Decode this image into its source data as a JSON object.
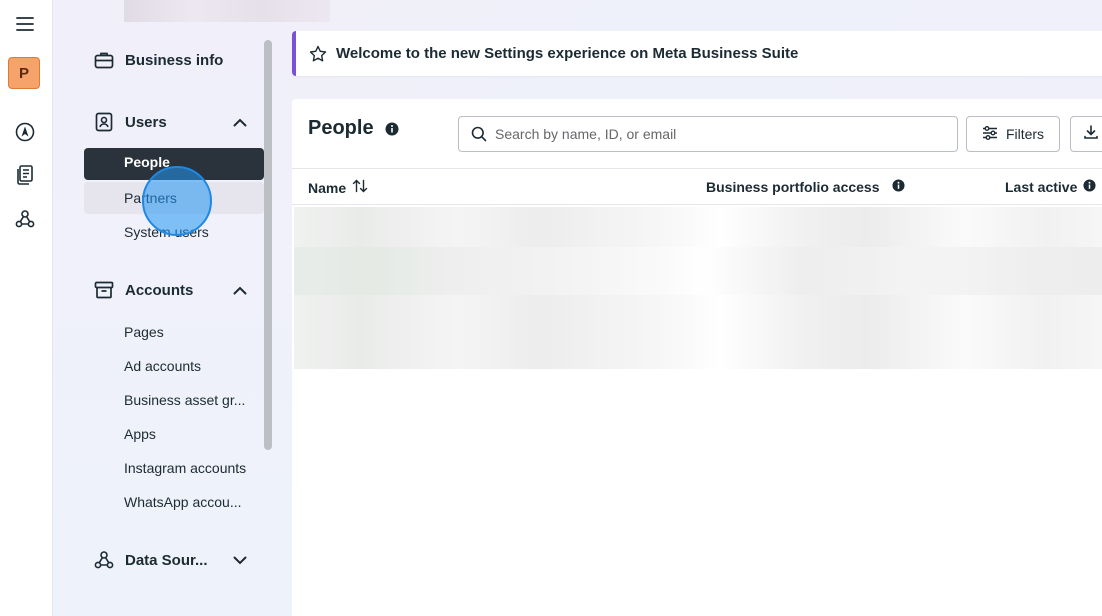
{
  "sidebar": {
    "business_info": "Business info",
    "users": {
      "label": "Users",
      "items": [
        "People",
        "Partners",
        "System users"
      ]
    },
    "accounts": {
      "label": "Accounts",
      "items": [
        "Pages",
        "Ad accounts",
        "Business asset gr...",
        "Apps",
        "Instagram accounts",
        "WhatsApp accou..."
      ]
    },
    "data_sources": "Data Sour..."
  },
  "rail": {
    "avatar_letter": "P"
  },
  "banner": {
    "text": "Welcome to the new Settings experience on Meta Business Suite"
  },
  "people": {
    "title": "People",
    "search_placeholder": "Search by name, ID, or email",
    "filters_label": "Filters",
    "columns": {
      "name": "Name",
      "access": "Business portfolio access",
      "last_active": "Last active"
    }
  },
  "colors": {
    "accent": "#7b4fd6",
    "active_nav_bg": "#2a333b",
    "avatar_bg": "#f5a36a"
  }
}
